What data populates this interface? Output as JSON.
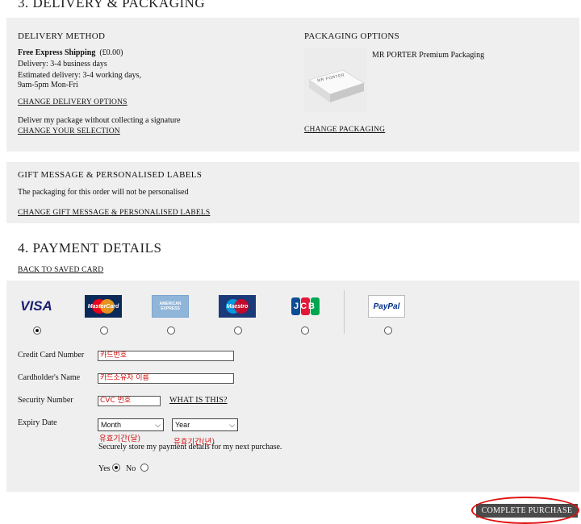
{
  "delivery": {
    "section_title": "3. DELIVERY & PACKAGING",
    "method_heading": "DELIVERY METHOD",
    "shipping_name": "Free Express Shipping",
    "shipping_price": "(£0.00)",
    "line1": "Delivery: 3-4 business days",
    "line2": "Estimated delivery: 3-4 working days,",
    "line3": "9am-5pm Mon-Fri",
    "change_delivery": "CHANGE DELIVERY OPTIONS",
    "signature_text": "Deliver my package without collecting a signature",
    "change_selection": "CHANGE YOUR SELECTION",
    "packaging_heading": "PACKAGING OPTIONS",
    "packaging_name": "MR PORTER Premium Packaging",
    "box_label": "MR PORTER",
    "change_packaging": "CHANGE PACKAGING"
  },
  "gift": {
    "heading": "GIFT MESSAGE & PERSONALISED LABELS",
    "text": "The packaging for this order will not be personalised",
    "change_link": "CHANGE GIFT MESSAGE & PERSONALISED LABELS"
  },
  "payment": {
    "section_title": "4. PAYMENT DETAILS",
    "back_link": "BACK TO SAVED CARD",
    "cards": [
      {
        "name": "VISA"
      },
      {
        "name": "MasterCard"
      },
      {
        "name": "AMERICAN EXPRESS"
      },
      {
        "name": "Maestro"
      },
      {
        "name": "JCB"
      },
      {
        "name": "PayPal"
      }
    ],
    "card_number_label": "Credit Card Number",
    "card_number_placeholder": "카드번호",
    "holder_label": "Cardholder's Name",
    "holder_placeholder": "카드소유자 이름",
    "security_label": "Security Number",
    "security_placeholder": "CVC 번호",
    "what_is_this": "WHAT IS THIS?",
    "expiry_label": "Expiry Date",
    "month": "Month",
    "year": "Year",
    "month_note": "유효기간(달)",
    "year_note": "유효기간(년)",
    "store_text": "Securely store my payment details for my next purchase.",
    "yes": "Yes",
    "no": "No",
    "complete_button": "COMPLETE PURCHASE"
  },
  "colors": {
    "panel_bg": "#efefef",
    "annotation_red": "#d01010",
    "button_bg": "#4a4a4a"
  }
}
